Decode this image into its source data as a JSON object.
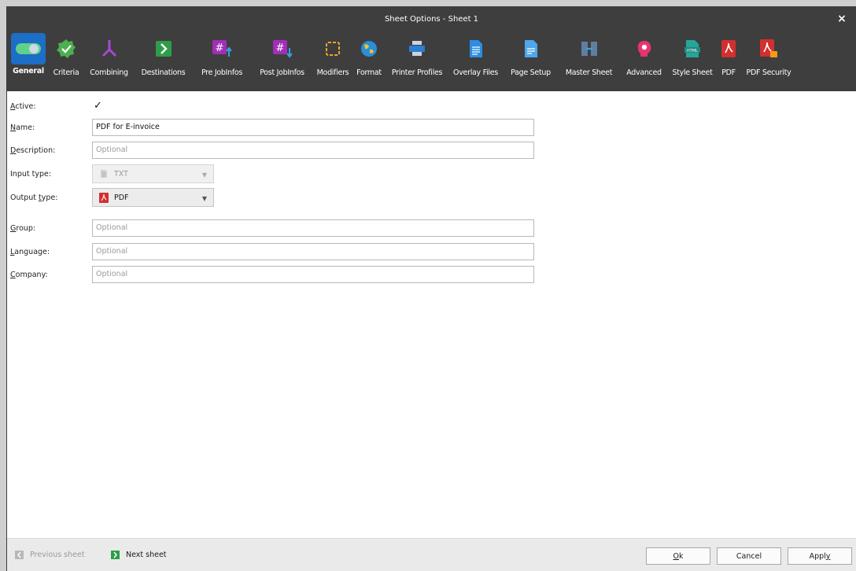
{
  "window": {
    "title": "Sheet Options - Sheet 1",
    "close_symbol": "×"
  },
  "toolbar": {
    "items": [
      {
        "label": "General",
        "icon": "toggle-icon",
        "active": true
      },
      {
        "label": "Criteria",
        "icon": "badge-check-icon"
      },
      {
        "label": "Combining",
        "icon": "merge-icon"
      },
      {
        "label": "Destinations",
        "icon": "arrow-right-box-icon"
      },
      {
        "label": "Pre JobInfos",
        "icon": "hash-up-icon"
      },
      {
        "label": "Post JobInfos",
        "icon": "hash-down-icon"
      },
      {
        "label": "Modifiers",
        "icon": "dotted-square-icon"
      },
      {
        "label": "Format",
        "icon": "globe-icon"
      },
      {
        "label": "Printer Profiles",
        "icon": "printer-icon"
      },
      {
        "label": "Overlay Files",
        "icon": "document-icon"
      },
      {
        "label": "Page Setup",
        "icon": "page-icon"
      },
      {
        "label": "Master Sheet",
        "icon": "master-sheet-icon"
      },
      {
        "label": "Advanced",
        "icon": "head-gear-icon"
      },
      {
        "label": "Style Sheet",
        "icon": "html-file-icon"
      },
      {
        "label": "PDF",
        "icon": "pdf-icon"
      },
      {
        "label": "PDF Security",
        "icon": "pdf-lock-icon"
      }
    ]
  },
  "form": {
    "active": {
      "label_u": "A",
      "label_rest": "ctive:",
      "checked": true,
      "check_symbol": "✓"
    },
    "name": {
      "label_u": "N",
      "label_rest": "ame:",
      "value": "PDF for E-invoice"
    },
    "description": {
      "label_u": "D",
      "label_rest": "escription:",
      "placeholder": "Optional"
    },
    "input_type": {
      "label": "Input type:",
      "value": "TXT"
    },
    "output_type": {
      "label_pre": "Output ",
      "label_u": "t",
      "label_rest": "ype:",
      "value": "PDF"
    },
    "group": {
      "label_u": "G",
      "label_rest": "roup:",
      "placeholder": "Optional"
    },
    "language": {
      "label_u": "L",
      "label_rest": "anguage:",
      "placeholder": "Optional"
    },
    "company": {
      "label_u": "C",
      "label_rest": "ompany:",
      "placeholder": "Optional"
    }
  },
  "footer": {
    "previous_sheet": "Previous sheet",
    "next_sheet": "Next sheet",
    "ok_u": "O",
    "ok_rest": "k",
    "cancel": "Cancel",
    "apply_pre": "Appl",
    "apply_u": "y"
  },
  "colors": {
    "titlebar": "#3e3e3e",
    "active_tab": "#1c6ec6",
    "green": "#4caf50",
    "purple": "#8e24aa",
    "red": "#d32f2f"
  }
}
